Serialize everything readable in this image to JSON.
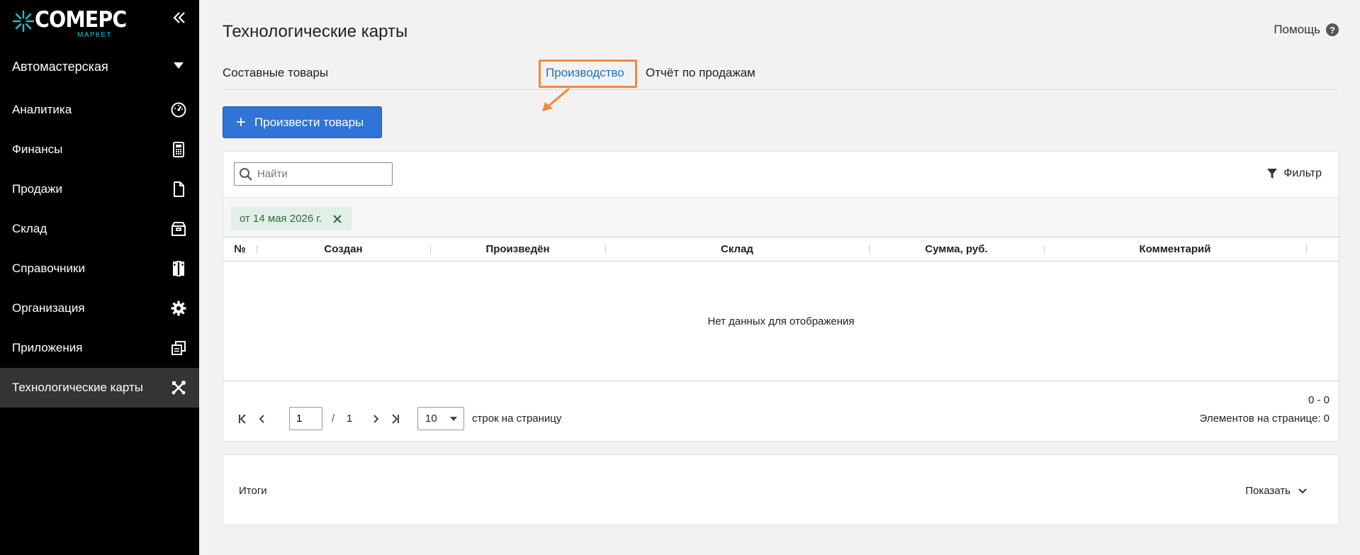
{
  "sidebar": {
    "logo": {
      "word": "COMEPC",
      "sub": "МАРКЕТ",
      "accent": "#19c3d0"
    },
    "org": {
      "label": "Автомастерская",
      "icon": "caret-down-icon"
    },
    "items": [
      {
        "label": "Аналитика",
        "icon": "speedometer-icon"
      },
      {
        "label": "Финансы",
        "icon": "calculator-icon"
      },
      {
        "label": "Продажи",
        "icon": "document-icon"
      },
      {
        "label": "Склад",
        "icon": "box-icon"
      },
      {
        "label": "Справочники",
        "icon": "books-icon"
      },
      {
        "label": "Организация",
        "icon": "gear-icon"
      },
      {
        "label": "Приложения",
        "icon": "windows-icon"
      },
      {
        "label": "Технологические карты",
        "icon": "tools-icon",
        "active": true
      }
    ]
  },
  "header": {
    "title": "Технологические карты",
    "help": "Помощь"
  },
  "tabs": [
    {
      "label": "Составные товары"
    },
    {
      "label": "Производство",
      "active": true
    },
    {
      "label": "Отчёт по продажам"
    }
  ],
  "toolbar": {
    "produce_label": "Произвести товары",
    "search_placeholder": "Найти",
    "filter_label": "Фильтр"
  },
  "chips": [
    {
      "label": "от 14 мая 2026 г."
    }
  ],
  "table": {
    "columns": [
      "№",
      "Создан",
      "Произведён",
      "Склад",
      "Сумма, руб.",
      "Комментарий"
    ],
    "empty_text": "Нет данных для отображения"
  },
  "pager": {
    "current_page": "1",
    "separator": "/",
    "total_pages": "1",
    "rows_per_page": "10",
    "rows_label": "строк на страницу",
    "range": "0 - 0",
    "items_on_page": "Элементов на странице: 0"
  },
  "totals": {
    "label": "Итоги",
    "show_label": "Показать"
  },
  "colors": {
    "sidebar_bg": "#000000",
    "sidebar_active": "#343434",
    "primary": "#2f74d6",
    "tab_active": "#1e6fc7",
    "highlight": "#f5873c",
    "chip_bg": "#e2efe6",
    "chip_text": "#2e6a43"
  }
}
